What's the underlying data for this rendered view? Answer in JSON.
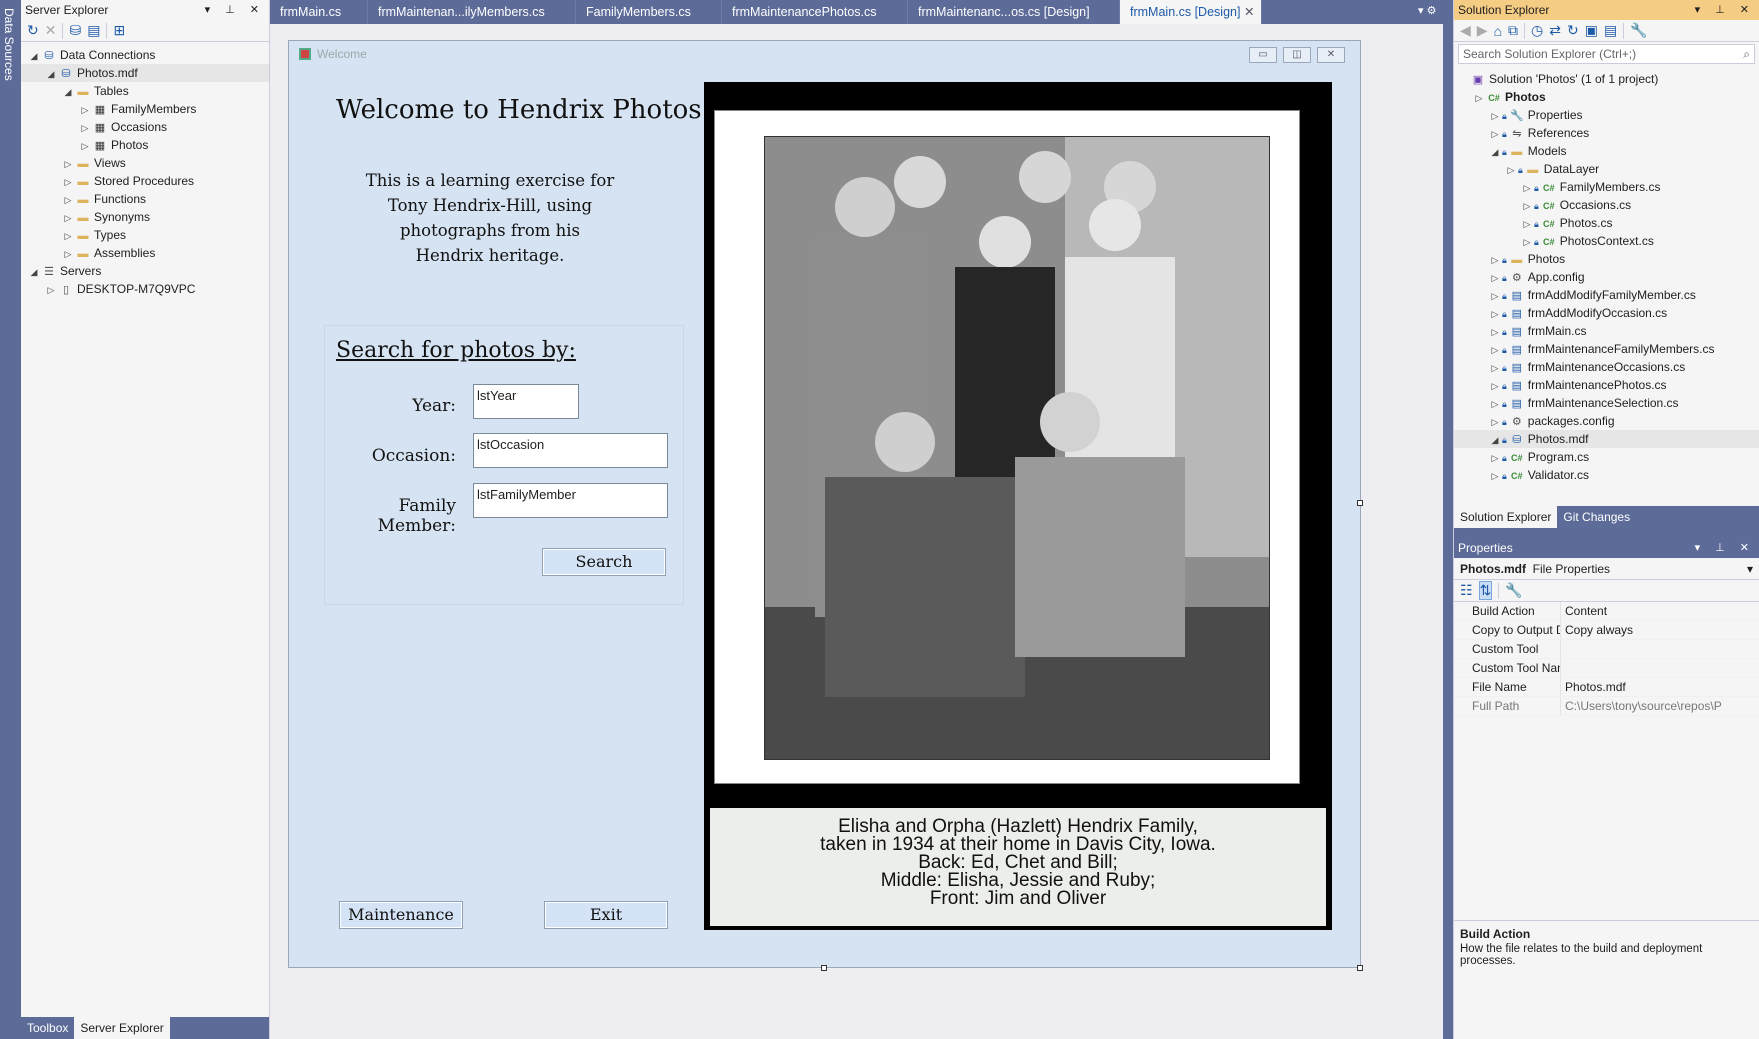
{
  "left_strip": {
    "label": "Data Sources"
  },
  "server_explorer": {
    "title": "Server Explorer",
    "tree": [
      {
        "label": "Data Connections",
        "level": 0,
        "icon": "data-connections-icon"
      },
      {
        "label": "Photos.mdf",
        "level": 1,
        "icon": "database-error-icon"
      },
      {
        "label": "Tables",
        "level": 2,
        "icon": "folder-icon"
      },
      {
        "label": "FamilyMembers",
        "level": 3,
        "icon": "table-icon"
      },
      {
        "label": "Occasions",
        "level": 3,
        "icon": "table-icon"
      },
      {
        "label": "Photos",
        "level": 3,
        "icon": "table-icon"
      },
      {
        "label": "Views",
        "level": 2,
        "icon": "folder-icon"
      },
      {
        "label": "Stored Procedures",
        "level": 2,
        "icon": "folder-icon"
      },
      {
        "label": "Functions",
        "level": 2,
        "icon": "folder-icon"
      },
      {
        "label": "Synonyms",
        "level": 2,
        "icon": "folder-icon"
      },
      {
        "label": "Types",
        "level": 2,
        "icon": "folder-icon"
      },
      {
        "label": "Assemblies",
        "level": 2,
        "icon": "folder-icon"
      },
      {
        "label": "Servers",
        "level": 0,
        "icon": "servers-icon"
      },
      {
        "label": "DESKTOP-M7Q9VPC",
        "level": 1,
        "icon": "computer-icon"
      }
    ],
    "bottom_tabs": [
      "Toolbox",
      "Server Explorer"
    ]
  },
  "doc_tabs": [
    "frmMain.cs",
    "frmMaintenan...ilyMembers.cs",
    "FamilyMembers.cs",
    "frmMaintenancePhotos.cs",
    "frmMaintenanc...os.cs [Design]",
    "frmMain.cs [Design]"
  ],
  "form": {
    "title": "Welcome",
    "heading": "Welcome to Hendrix Photos!",
    "intro": [
      "This is a learning exercise for",
      "Tony Hendrix-Hill, using",
      "photographs from his",
      "Hendrix heritage."
    ],
    "search_heading": "Search for photos by:",
    "year_label": "Year:",
    "year_value": "lstYear",
    "occasion_label": "Occasion:",
    "occasion_value": "lstOccasion",
    "member_label": "Family Member:",
    "member_value": "lstFamilyMember",
    "search_button": "Search",
    "maintenance_button": "Maintenance",
    "exit_button": "Exit",
    "caption": [
      "Elisha and Orpha (Hazlett) Hendrix Family,",
      "taken in 1934 at their home in Davis City, Iowa.",
      "Back: Ed, Chet and Bill;",
      "Middle: Elisha, Jessie and Ruby;",
      "Front: Jim and Oliver"
    ]
  },
  "solution_explorer": {
    "title": "Solution Explorer",
    "search_placeholder": "Search Solution Explorer (Ctrl+;)",
    "tree": [
      {
        "label": "Solution 'Photos' (1 of 1 project)",
        "level": 0,
        "icon": "solution-icon",
        "bold": false
      },
      {
        "label": "Photos",
        "level": 1,
        "icon": "csharp-project-icon",
        "bold": true
      },
      {
        "label": "Properties",
        "level": 2,
        "icon": "wrench-icon"
      },
      {
        "label": "References",
        "level": 2,
        "icon": "references-icon"
      },
      {
        "label": "Models",
        "level": 2,
        "icon": "folder-icon"
      },
      {
        "label": "DataLayer",
        "level": 3,
        "icon": "folder-icon"
      },
      {
        "label": "FamilyMembers.cs",
        "level": 4,
        "icon": "csharp-file-icon"
      },
      {
        "label": "Occasions.cs",
        "level": 4,
        "icon": "csharp-file-icon"
      },
      {
        "label": "Photos.cs",
        "level": 4,
        "icon": "csharp-file-icon"
      },
      {
        "label": "PhotosContext.cs",
        "level": 4,
        "icon": "csharp-file-icon"
      },
      {
        "label": "Photos",
        "level": 2,
        "icon": "folder-icon"
      },
      {
        "label": "App.config",
        "level": 2,
        "icon": "config-file-icon"
      },
      {
        "label": "frmAddModifyFamilyMember.cs",
        "level": 2,
        "icon": "form-file-icon"
      },
      {
        "label": "frmAddModifyOccasion.cs",
        "level": 2,
        "icon": "form-file-icon"
      },
      {
        "label": "frmMain.cs",
        "level": 2,
        "icon": "form-file-icon"
      },
      {
        "label": "frmMaintenanceFamilyMembers.cs",
        "level": 2,
        "icon": "form-file-icon"
      },
      {
        "label": "frmMaintenanceOccasions.cs",
        "level": 2,
        "icon": "form-file-icon"
      },
      {
        "label": "frmMaintenancePhotos.cs",
        "level": 2,
        "icon": "form-file-icon"
      },
      {
        "label": "frmMaintenanceSelection.cs",
        "level": 2,
        "icon": "form-file-icon"
      },
      {
        "label": "packages.config",
        "level": 2,
        "icon": "config-file-icon"
      },
      {
        "label": "Photos.mdf",
        "level": 2,
        "icon": "database-file-icon"
      },
      {
        "label": "Program.cs",
        "level": 2,
        "icon": "csharp-file-icon"
      },
      {
        "label": "Validator.cs",
        "level": 2,
        "icon": "csharp-file-icon"
      }
    ],
    "tabs": [
      "Solution Explorer",
      "Git Changes"
    ]
  },
  "properties": {
    "title": "Properties",
    "object_name": "Photos.mdf",
    "object_type": "File Properties",
    "rows": [
      {
        "key": "Build Action",
        "value": "Content"
      },
      {
        "key": "Copy to Output Dir",
        "value": "Copy always"
      },
      {
        "key": "Custom Tool",
        "value": ""
      },
      {
        "key": "Custom Tool Name",
        "value": ""
      },
      {
        "key": "File Name",
        "value": "Photos.mdf"
      },
      {
        "key": "Full Path",
        "value": "C:\\Users\\tony\\source\\repos\\P"
      }
    ],
    "desc_title": "Build Action",
    "desc_text": "How the file relates to the build and deployment processes."
  }
}
